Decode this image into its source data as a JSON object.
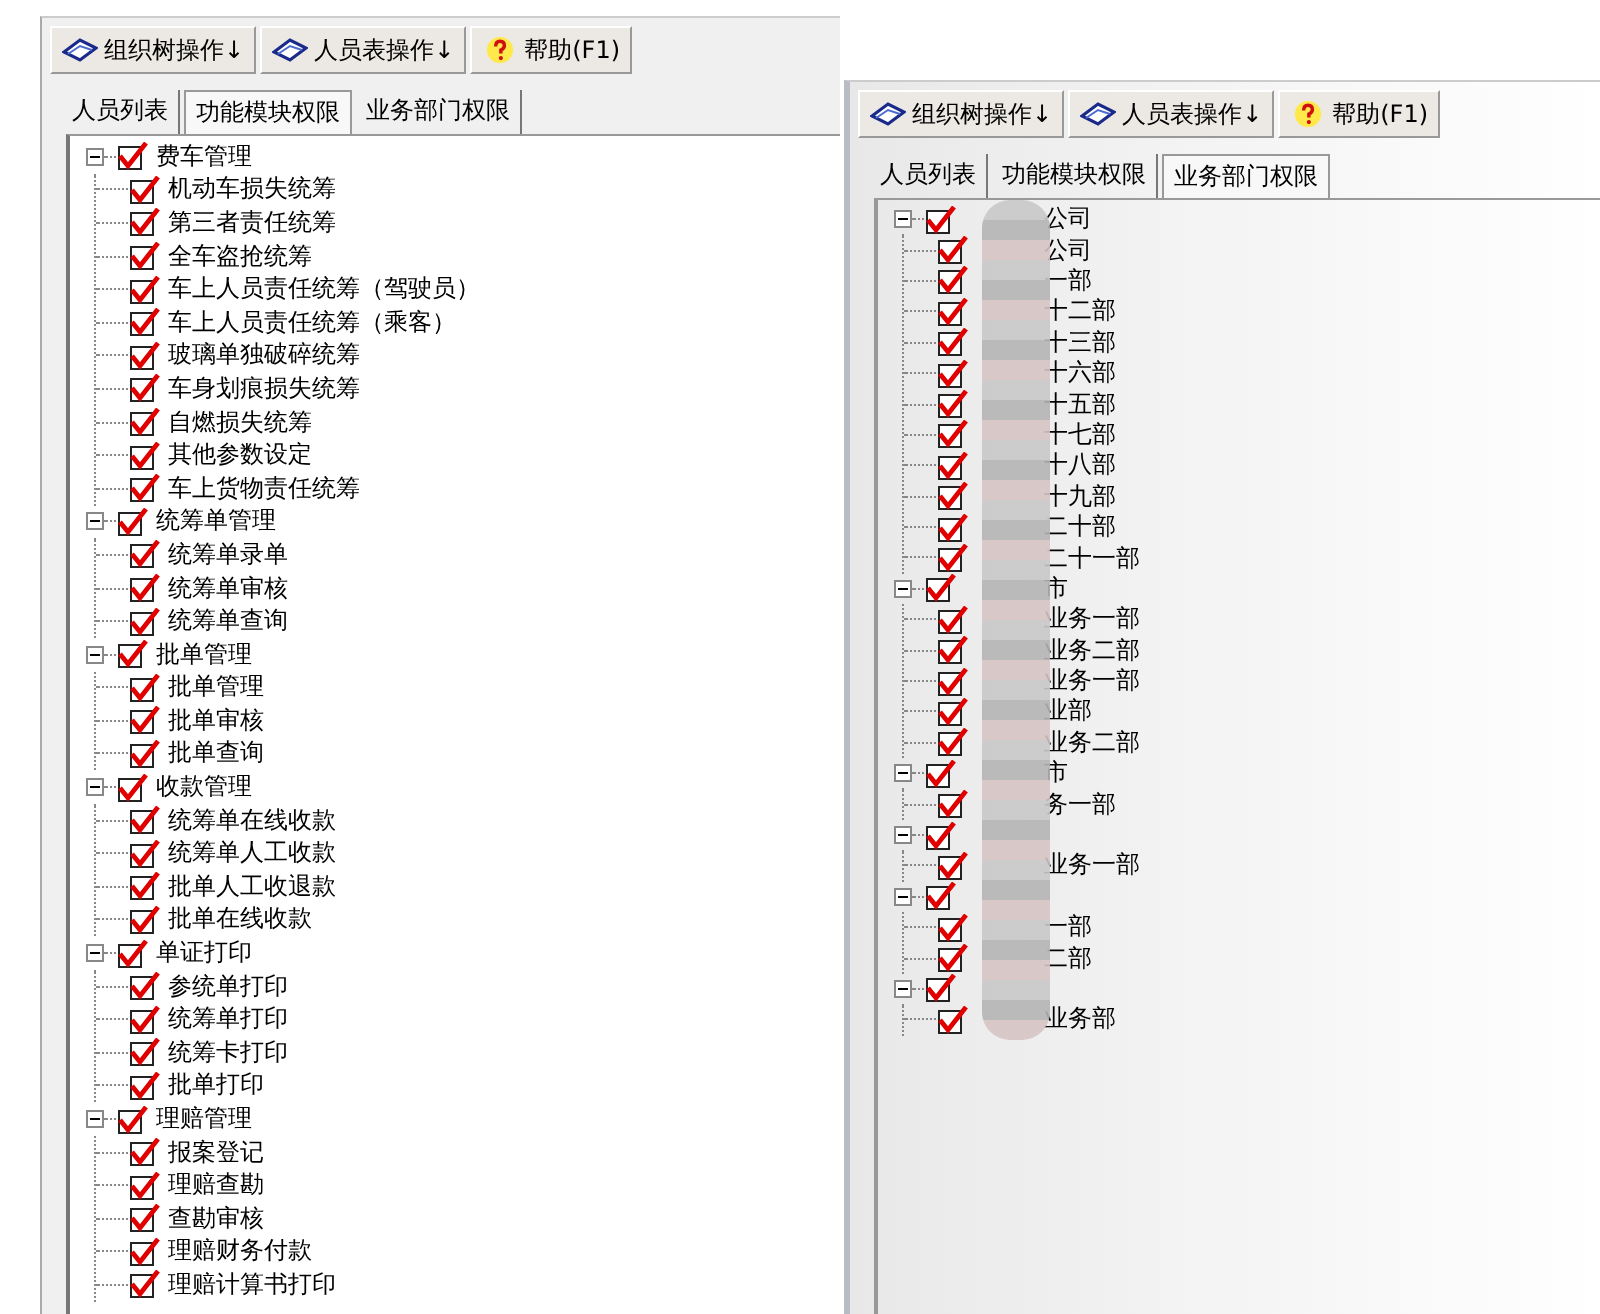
{
  "left_window": {
    "toolbar": [
      {
        "label": "组织树操作↓",
        "kind": "book"
      },
      {
        "label": "人员表操作↓",
        "kind": "book"
      },
      {
        "label": "帮助(F1)",
        "kind": "help"
      }
    ],
    "tabs": [
      {
        "label": "人员列表",
        "selected": false
      },
      {
        "label": "功能模块权限",
        "selected": true
      },
      {
        "label": "业务部门权限",
        "selected": false
      }
    ],
    "tree": [
      {
        "label": "费车管理",
        "checked": true,
        "expanded": true,
        "children": [
          {
            "label": "机动车损失统筹",
            "checked": true
          },
          {
            "label": "第三者责任统筹",
            "checked": true
          },
          {
            "label": "全车盗抢统筹",
            "checked": true
          },
          {
            "label": "车上人员责任统筹（驾驶员）",
            "checked": true
          },
          {
            "label": "车上人员责任统筹（乘客）",
            "checked": true
          },
          {
            "label": "玻璃单独破碎统筹",
            "checked": true
          },
          {
            "label": "车身划痕损失统筹",
            "checked": true
          },
          {
            "label": "自燃损失统筹",
            "checked": true
          },
          {
            "label": "其他参数设定",
            "checked": true
          },
          {
            "label": "车上货物责任统筹",
            "checked": true
          }
        ]
      },
      {
        "label": "统筹单管理",
        "checked": true,
        "expanded": true,
        "children": [
          {
            "label": "统筹单录单",
            "checked": true
          },
          {
            "label": "统筹单审核",
            "checked": true
          },
          {
            "label": "统筹单查询",
            "checked": true
          }
        ]
      },
      {
        "label": "批单管理",
        "checked": true,
        "expanded": true,
        "children": [
          {
            "label": "批单管理",
            "checked": true
          },
          {
            "label": "批单审核",
            "checked": true
          },
          {
            "label": "批单查询",
            "checked": true
          }
        ]
      },
      {
        "label": "收款管理",
        "checked": true,
        "expanded": true,
        "children": [
          {
            "label": "统筹单在线收款",
            "checked": true
          },
          {
            "label": "统筹单人工收款",
            "checked": true
          },
          {
            "label": "批单人工收退款",
            "checked": true
          },
          {
            "label": "批单在线收款",
            "checked": true
          }
        ]
      },
      {
        "label": "单证打印",
        "checked": true,
        "expanded": true,
        "children": [
          {
            "label": "参统单打印",
            "checked": true
          },
          {
            "label": "统筹单打印",
            "checked": true
          },
          {
            "label": "统筹卡打印",
            "checked": true
          },
          {
            "label": "批单打印",
            "checked": true
          }
        ]
      },
      {
        "label": "理赔管理",
        "checked": true,
        "expanded": true,
        "children": [
          {
            "label": "报案登记",
            "checked": true
          },
          {
            "label": "理赔查勘",
            "checked": true
          },
          {
            "label": "查勘审核",
            "checked": true
          },
          {
            "label": "理赔财务付款",
            "checked": true
          },
          {
            "label": "理赔计算书打印",
            "checked": true
          }
        ]
      }
    ]
  },
  "right_window": {
    "toolbar": [
      {
        "label": "组织树操作↓",
        "kind": "book"
      },
      {
        "label": "人员表操作↓",
        "kind": "book"
      },
      {
        "label": "帮助(F1)",
        "kind": "help"
      }
    ],
    "tabs": [
      {
        "label": "人员列表",
        "selected": false
      },
      {
        "label": "功能模块权限",
        "selected": false
      },
      {
        "label": "业务部门权限",
        "selected": true
      }
    ],
    "tree": [
      {
        "label": "公司",
        "checked": true,
        "expanded": true,
        "children": [
          {
            "label": "公司",
            "checked": true
          },
          {
            "label": "一部",
            "checked": true
          },
          {
            "label": "十二部",
            "checked": true
          },
          {
            "label": "十三部",
            "checked": true
          },
          {
            "label": "十六部",
            "checked": true
          },
          {
            "label": "十五部",
            "checked": true
          },
          {
            "label": "十七部",
            "checked": true
          },
          {
            "label": "十八部",
            "checked": true
          },
          {
            "label": "十九部",
            "checked": true
          },
          {
            "label": "二十部",
            "checked": true
          },
          {
            "label": "二十一部",
            "checked": true
          }
        ]
      },
      {
        "label": "市",
        "checked": true,
        "expanded": true,
        "children": [
          {
            "label": "业务一部",
            "checked": true
          },
          {
            "label": "业务二部",
            "checked": true
          },
          {
            "label": "业务一部",
            "checked": true
          },
          {
            "label": "业部",
            "checked": true
          },
          {
            "label": "业务二部",
            "checked": true
          }
        ]
      },
      {
        "label": "市",
        "checked": true,
        "expanded": true,
        "children": [
          {
            "label": "务一部",
            "checked": true
          }
        ]
      },
      {
        "checked": true,
        "expanded": true,
        "children": [
          {
            "label": "业务一部",
            "checked": true
          }
        ]
      },
      {
        "checked": true,
        "expanded": true,
        "children": [
          {
            "label": "一部",
            "checked": true
          },
          {
            "label": "二部",
            "checked": true
          }
        ]
      },
      {
        "checked": true,
        "expanded": true,
        "children": [
          {
            "label": "业务部",
            "checked": true
          }
        ]
      }
    ]
  }
}
